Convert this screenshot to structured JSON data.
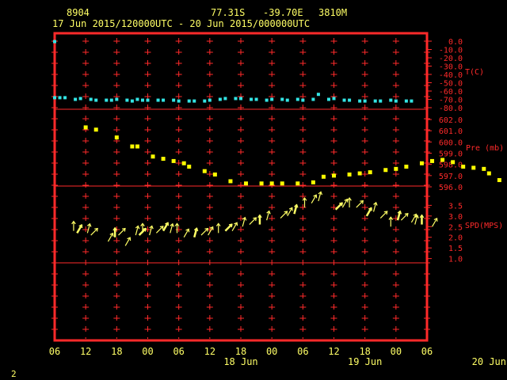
{
  "header": {
    "station_id": "8904",
    "lat": "77.31S",
    "lon": "-39.70E",
    "elevation": "3810M",
    "time_range": "17 Jun 2015/120000UTC - 20 Jun 2015/000000UTC"
  },
  "footer": {
    "page_number": "2"
  },
  "colors": {
    "frame": "#ff2a2a",
    "axis_text": "#ffff66",
    "temperature": "#33e5e5",
    "pressure": "#ffff00",
    "wind": "#ffff66"
  },
  "x_axis": {
    "tick_labels": [
      "06",
      "12",
      "18",
      "00",
      "06",
      "12",
      "18",
      "00",
      "06",
      "12",
      "18",
      "00",
      "06"
    ],
    "date_labels": [
      {
        "label": "18 Jun",
        "hour": 42
      },
      {
        "label": "19 Jun",
        "hour": 66
      },
      {
        "label": "20 Jun",
        "hour": 90
      }
    ]
  },
  "chart_data": [
    {
      "type": "scatter",
      "name": "T(C)",
      "x_unit": "hours since 17 Jun 2015 06 UTC",
      "ylim": [
        -80,
        0
      ],
      "ytick_labels": [
        "0.0",
        "-10.0",
        "-20.0",
        "-30.0",
        "-40.0",
        "-50.0",
        "-60.0",
        "-70.0",
        "-80.0"
      ],
      "x": [
        0,
        0,
        1,
        2,
        4,
        5,
        7,
        8,
        10,
        11,
        12,
        14,
        15,
        16,
        17,
        18,
        20,
        21,
        23,
        24,
        26,
        27,
        29,
        30,
        32,
        33,
        35,
        36,
        38,
        39,
        41,
        42,
        44,
        45,
        47,
        48,
        50,
        51,
        53,
        54,
        56,
        57,
        59,
        60,
        62,
        63,
        65,
        66,
        68,
        69
      ],
      "y": [
        -0.5,
        -68,
        -68,
        -68,
        -70,
        -69,
        -70,
        -71,
        -71,
        -71,
        -70,
        -71,
        -72,
        -70,
        -71,
        -71,
        -71,
        -71,
        -71,
        -72,
        -72,
        -72,
        -72,
        -71,
        -70,
        -69,
        -69,
        -69,
        -70,
        -70,
        -71,
        -70,
        -70,
        -71,
        -70,
        -71,
        -70,
        -64,
        -70,
        -69,
        -71,
        -71,
        -72,
        -72,
        -72,
        -72,
        -71,
        -72,
        -72,
        -72
      ]
    },
    {
      "type": "scatter",
      "name": "Pre (mb)",
      "x_unit": "hours since 17 Jun 2015 06 UTC",
      "ylim": [
        596,
        602
      ],
      "ytick_labels": [
        "602.0",
        "601.0",
        "600.0",
        "599.0",
        "598.0",
        "597.0",
        "596.0"
      ],
      "x": [
        6,
        8,
        12,
        15,
        16,
        19,
        21,
        23,
        25,
        26,
        29,
        31,
        34,
        37,
        40,
        42,
        44,
        47,
        50,
        52,
        54,
        57,
        59,
        61,
        64,
        66,
        68,
        71,
        73,
        75,
        77,
        79,
        81,
        83,
        84,
        86
      ],
      "y": [
        601.3,
        601.1,
        600.4,
        599.6,
        599.6,
        598.7,
        598.5,
        598.3,
        598.1,
        597.8,
        597.4,
        597.1,
        596.5,
        596.3,
        596.3,
        596.3,
        596.3,
        596.3,
        596.4,
        596.9,
        597.0,
        597.1,
        597.2,
        597.3,
        597.5,
        597.6,
        597.8,
        598.1,
        598.3,
        598.4,
        598.2,
        597.8,
        597.7,
        597.6,
        597.2,
        596.6
      ]
    },
    {
      "type": "scatter",
      "name": "SPD(MPS)",
      "x_unit": "hours since 17 Jun 2015 06 UTC",
      "ylim": [
        0.8,
        3.7
      ],
      "ytick_labels": [
        "3.5",
        "3.0",
        "2.5",
        "2.0",
        "1.5",
        "1.0"
      ],
      "x": [
        1,
        2,
        5,
        6,
        11,
        13,
        14,
        16,
        19,
        20,
        21,
        23,
        25,
        27,
        29,
        31,
        33,
        36,
        38,
        40,
        43,
        45,
        47,
        50,
        52,
        55,
        57,
        61,
        63,
        65,
        68,
        70,
        72,
        77,
        79,
        81,
        83,
        86,
        88,
        90,
        93,
        95,
        96,
        99,
        100,
        102,
        105
      ],
      "y": [
        2.3,
        2.2,
        2.2,
        2.1,
        1.8,
        2.0,
        2.1,
        1.6,
        2.1,
        2.1,
        2.2,
        2.1,
        2.2,
        2.3,
        2.2,
        2.2,
        2.0,
        2.0,
        2.1,
        2.1,
        2.2,
        2.3,
        2.3,
        2.5,
        2.6,
        2.6,
        2.8,
        2.9,
        3.0,
        3.1,
        3.4,
        3.6,
        3.7,
        3.3,
        3.4,
        3.4,
        3.4,
        3.0,
        3.2,
        2.9,
        2.5,
        2.8,
        2.8,
        2.7,
        2.6,
        2.6,
        2.5
      ]
    }
  ]
}
